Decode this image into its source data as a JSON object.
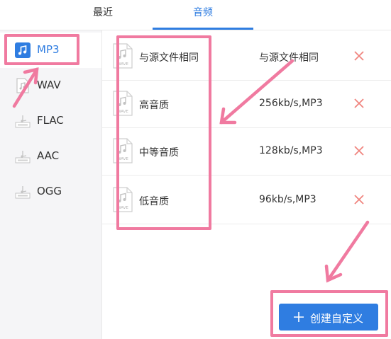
{
  "tabs": [
    {
      "label": "最近"
    },
    {
      "label": "音频"
    }
  ],
  "formats": [
    {
      "label": "MP3"
    },
    {
      "label": "WAV"
    },
    {
      "label": "FLAC"
    },
    {
      "label": "AAC"
    },
    {
      "label": "OGG"
    }
  ],
  "presets": [
    {
      "name": "与源文件相同",
      "value": "与源文件相同"
    },
    {
      "name": "高音质",
      "value": "256kb/s,MP3"
    },
    {
      "name": "中等音质",
      "value": "128kb/s,MP3"
    },
    {
      "name": "低音质",
      "value": "96kb/s,MP3"
    }
  ],
  "file_icon_text": "WAVE",
  "create_button": {
    "label": "创建自定义"
  },
  "colors": {
    "accent": "#2f7de1",
    "annotation": "#f07aa0",
    "delete": "#f0857f"
  }
}
